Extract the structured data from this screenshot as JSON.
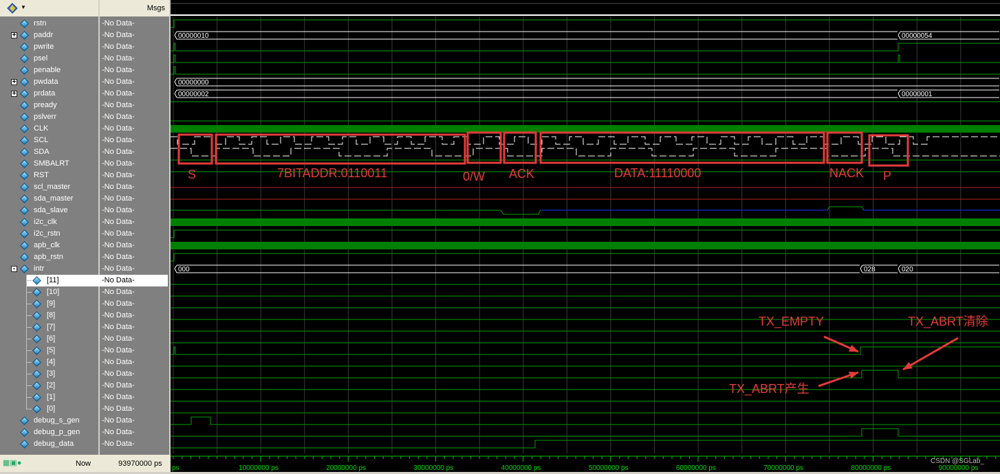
{
  "header": {
    "msgs_label": "Msgs"
  },
  "signals": [
    {
      "name": "rstn",
      "value": "-No Data-",
      "level": 1,
      "expander": ""
    },
    {
      "name": "paddr",
      "value": "-No Data-",
      "level": 1,
      "expander": "+"
    },
    {
      "name": "pwrite",
      "value": "-No Data-",
      "level": 1,
      "expander": ""
    },
    {
      "name": "psel",
      "value": "-No Data-",
      "level": 1,
      "expander": ""
    },
    {
      "name": "penable",
      "value": "-No Data-",
      "level": 1,
      "expander": ""
    },
    {
      "name": "pwdata",
      "value": "-No Data-",
      "level": 1,
      "expander": "+"
    },
    {
      "name": "prdata",
      "value": "-No Data-",
      "level": 1,
      "expander": "+"
    },
    {
      "name": "pready",
      "value": "-No Data-",
      "level": 1,
      "expander": ""
    },
    {
      "name": "pslverr",
      "value": "-No Data-",
      "level": 1,
      "expander": ""
    },
    {
      "name": "CLK",
      "value": "-No Data-",
      "level": 1,
      "expander": ""
    },
    {
      "name": "SCL",
      "value": "-No Data-",
      "level": 1,
      "expander": ""
    },
    {
      "name": "SDA",
      "value": "-No Data-",
      "level": 1,
      "expander": ""
    },
    {
      "name": "SMBALRT",
      "value": "-No Data-",
      "level": 1,
      "expander": ""
    },
    {
      "name": "RST",
      "value": "-No Data-",
      "level": 1,
      "expander": ""
    },
    {
      "name": "scl_master",
      "value": "-No Data-",
      "level": 1,
      "expander": ""
    },
    {
      "name": "sda_master",
      "value": "-No Data-",
      "level": 1,
      "expander": ""
    },
    {
      "name": "sda_slave",
      "value": "-No Data-",
      "level": 1,
      "expander": ""
    },
    {
      "name": "i2c_clk",
      "value": "-No Data-",
      "level": 1,
      "expander": ""
    },
    {
      "name": "i2c_rstn",
      "value": "-No Data-",
      "level": 1,
      "expander": ""
    },
    {
      "name": "apb_clk",
      "value": "-No Data-",
      "level": 1,
      "expander": ""
    },
    {
      "name": "apb_rstn",
      "value": "-No Data-",
      "level": 1,
      "expander": ""
    },
    {
      "name": "intr",
      "value": "-No Data-",
      "level": 1,
      "expander": "-"
    },
    {
      "name": "[11]",
      "value": "-No Data-",
      "level": 2,
      "expander": "",
      "selected": true
    },
    {
      "name": "[10]",
      "value": "-No Data-",
      "level": 2,
      "expander": ""
    },
    {
      "name": "[9]",
      "value": "-No Data-",
      "level": 2,
      "expander": ""
    },
    {
      "name": "[8]",
      "value": "-No Data-",
      "level": 2,
      "expander": ""
    },
    {
      "name": "[7]",
      "value": "-No Data-",
      "level": 2,
      "expander": ""
    },
    {
      "name": "[6]",
      "value": "-No Data-",
      "level": 2,
      "expander": ""
    },
    {
      "name": "[5]",
      "value": "-No Data-",
      "level": 2,
      "expander": ""
    },
    {
      "name": "[4]",
      "value": "-No Data-",
      "level": 2,
      "expander": ""
    },
    {
      "name": "[3]",
      "value": "-No Data-",
      "level": 2,
      "expander": ""
    },
    {
      "name": "[2]",
      "value": "-No Data-",
      "level": 2,
      "expander": ""
    },
    {
      "name": "[1]",
      "value": "-No Data-",
      "level": 2,
      "expander": ""
    },
    {
      "name": "[0]",
      "value": "-No Data-",
      "level": 2,
      "expander": ""
    },
    {
      "name": "debug_s_gen",
      "value": "-No Data-",
      "level": 1,
      "expander": ""
    },
    {
      "name": "debug_p_gen",
      "value": "-No Data-",
      "level": 1,
      "expander": ""
    },
    {
      "name": "debug_data",
      "value": "-No Data-",
      "level": 1,
      "expander": ""
    }
  ],
  "bus_values": {
    "paddr_start": "00000010",
    "paddr_end": "00000054",
    "pwdata_start": "00000000",
    "prdata_start": "00000002",
    "prdata_end": "00000001",
    "intr_start": "000",
    "intr_mid": "028",
    "intr_end": "020"
  },
  "annotations": {
    "s": "S",
    "addr": "7BITADDR:0110011",
    "rw": "0/W",
    "ack": "ACK",
    "data": "DATA:11110000",
    "nack": "NACK",
    "p": "P",
    "tx_empty": "TX_EMPTY",
    "tx_abrt_set": "TX_ABRT产生",
    "tx_abrt_clear": "TX_ABRT清除"
  },
  "timeline": {
    "now_label": "Now",
    "now_value": "93970000 ps",
    "ticks": [
      "10000000 ps",
      "20000000 ps",
      "30000000 ps",
      "40000000 ps",
      "50000000 ps",
      "60000000 ps",
      "70000000 ps",
      "80000000 ps",
      "90000000 ps"
    ],
    "first_tick_fragment": "ps",
    "watermark": "CSDN @SGLab_"
  },
  "colors": {
    "wave": "#00a000",
    "annotation": "#e53b3b",
    "grid": "#3a3a3a",
    "bus": "#ffffff",
    "blue": "#2030ff",
    "red": "#c02020"
  }
}
